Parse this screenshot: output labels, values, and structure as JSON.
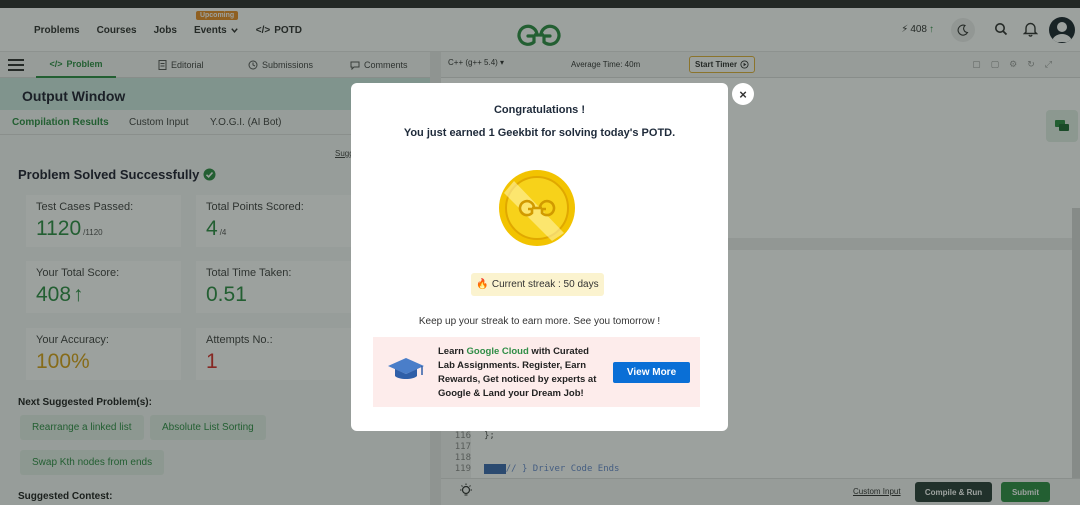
{
  "nav": {
    "items": [
      "Problems",
      "Courses",
      "Jobs"
    ],
    "events_label": "Events",
    "upcoming_badge": "Upcoming",
    "potd_label": "POTD",
    "score": "408"
  },
  "problem_tabs": {
    "problem": "Problem",
    "editorial": "Editorial",
    "submissions": "Submissions",
    "comments": "Comments"
  },
  "editor_bar": {
    "language": "C++ (g++ 5.4)",
    "average_time": "Average Time: 40m",
    "start_timer": "Start Timer"
  },
  "output": {
    "title": "Output Window",
    "tabs": [
      "Compilation Results",
      "Custom Input",
      "Y.O.G.I. (AI Bot)"
    ],
    "suggest_link": "Sugg",
    "status": "Problem Solved Successfully",
    "cards": {
      "tests_label": "Test Cases Passed:",
      "tests_value": "1120",
      "tests_total": "/1120",
      "points_label": "Total Points Scored:",
      "points_value": "4",
      "points_total": "/4",
      "score_label": "Your Total Score:",
      "score_value": "408",
      "time_label": "Total Time Taken:",
      "time_value": "0.51",
      "accuracy_label": "Your Accuracy:",
      "accuracy_value": "100%",
      "attempts_label": "Attempts No.:",
      "attempts_value": "1"
    },
    "next_heading": "Next Suggested Problem(s):",
    "suggestions": [
      "Rearrange a linked list",
      "Absolute List Sorting",
      "Swap Kth nodes from ends"
    ],
    "contest_heading": "Suggested Contest:"
  },
  "code": {
    "lines": [
      {
        "num": "116",
        "text": "};"
      },
      {
        "num": "117",
        "text": ""
      },
      {
        "num": "118",
        "text": ""
      },
      {
        "num": "119",
        "text": "// } Driver Code Ends"
      }
    ]
  },
  "bottom": {
    "custom_input": "Custom Input",
    "compile_run": "Compile & Run",
    "submit": "Submit"
  },
  "modal": {
    "title": "Congratulations !",
    "message": "You just earned 1 Geekbit for solving today's POTD.",
    "streak": "Current streak : 50 days",
    "keep_up": "Keep up your streak to earn more. See you tomorrow !",
    "promo_learn": "Learn ",
    "promo_brand": "Google Cloud",
    "promo_rest": " with Curated Lab Assignments. Register, Earn Rewards, Get noticed by experts at Google & Land your Dream Job!",
    "view_more": "View More",
    "close": "×"
  },
  "colors": {
    "brand_green": "#2f8d46",
    "accuracy_orange": "#d9a21b",
    "attempts_red": "#d9302c",
    "promo_button": "#0a6fd6"
  }
}
